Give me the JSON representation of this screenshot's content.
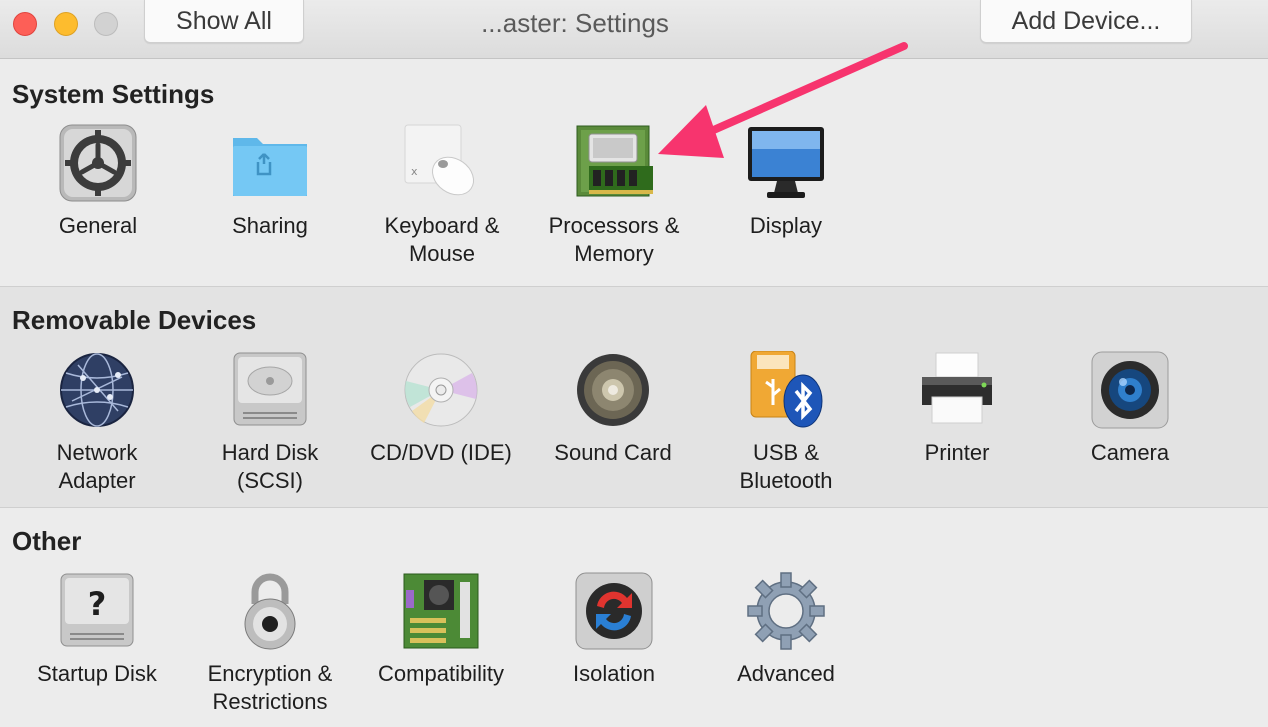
{
  "window": {
    "title": "...aster: Settings",
    "show_all_label": "Show All",
    "add_device_label": "Add Device..."
  },
  "sections": [
    {
      "title": "System Settings",
      "items": [
        {
          "label": "General",
          "icon": "gear-icon"
        },
        {
          "label": "Sharing",
          "icon": "shared-folder-icon"
        },
        {
          "label": "Keyboard &\nMouse",
          "icon": "keyboard-mouse-icon"
        },
        {
          "label": "Processors &\nMemory",
          "icon": "memory-module-icon"
        },
        {
          "label": "Display",
          "icon": "monitor-icon"
        }
      ]
    },
    {
      "title": "Removable Devices",
      "items": [
        {
          "label": "Network\nAdapter",
          "icon": "globe-network-icon"
        },
        {
          "label": "Hard Disk\n(SCSI)",
          "icon": "hard-disk-icon"
        },
        {
          "label": "CD/DVD (IDE)",
          "icon": "cd-icon"
        },
        {
          "label": "Sound Card",
          "icon": "speaker-icon"
        },
        {
          "label": "USB &\nBluetooth",
          "icon": "usb-bluetooth-icon"
        },
        {
          "label": "Printer",
          "icon": "printer-icon"
        },
        {
          "label": "Camera",
          "icon": "camera-icon"
        }
      ]
    },
    {
      "title": "Other",
      "items": [
        {
          "label": "Startup Disk",
          "icon": "startup-disk-icon"
        },
        {
          "label": "Encryption &\nRestrictions",
          "icon": "padlock-icon"
        },
        {
          "label": "Compatibility",
          "icon": "motherboard-icon"
        },
        {
          "label": "Isolation",
          "icon": "isolation-icon"
        },
        {
          "label": "Advanced",
          "icon": "advanced-gear-icon"
        }
      ]
    }
  ],
  "annotation": {
    "color": "#f7346e",
    "target": "Processors & Memory"
  },
  "colors": {
    "accent_arrow": "#f7346e",
    "close": "#fd5f57",
    "minimize": "#fdbc2e",
    "maximize": "#d2d2d2"
  }
}
